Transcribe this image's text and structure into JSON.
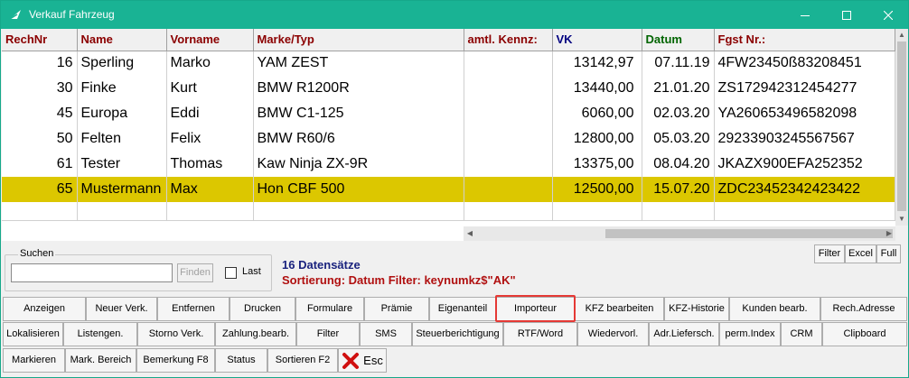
{
  "window": {
    "title": "Verkauf Fahrzeug",
    "controls": [
      "minimize-icon",
      "maximize-icon",
      "close-icon"
    ]
  },
  "grid": {
    "columns": [
      {
        "label": "RechNr",
        "color": "#8b0000"
      },
      {
        "label": "Name",
        "color": "#8b0000"
      },
      {
        "label": "Vorname",
        "color": "#8b0000"
      },
      {
        "label": "Marke/Typ",
        "color": "#8b0000"
      },
      {
        "label": "amtl. Kennz:",
        "color": "#8b0000"
      },
      {
        "label": "VK",
        "color": "#000080"
      },
      {
        "label": "Datum",
        "color": "#006400"
      },
      {
        "label": "Fgst Nr.:",
        "color": "#8b0000"
      }
    ],
    "rows": [
      [
        "16",
        "Sperling",
        "Marko",
        "YAM ZEST",
        "",
        "13142,97",
        "07.11.19",
        "4FW23450ß83208451"
      ],
      [
        "30",
        "Finke",
        "Kurt",
        "BMW R1200R",
        "",
        "13440,00",
        "21.01.20",
        "ZS172942312454277"
      ],
      [
        "45",
        "Europa",
        "Eddi",
        "BMW C1-125",
        "",
        "6060,00",
        "02.03.20",
        "YA260653496582098"
      ],
      [
        "50",
        "Felten",
        "Felix",
        "BMW R60/6",
        "",
        "12800,00",
        "05.03.20",
        "29233903245567567"
      ],
      [
        "61",
        "Tester",
        "Thomas",
        "Kaw Ninja ZX-9R",
        "",
        "13375,00",
        "08.04.20",
        "JKAZX900EFA252352"
      ],
      [
        "65",
        "Mustermann",
        "Max",
        "Hon CBF 500",
        "",
        "12500,00",
        "15.07.20",
        "ZDC23452342423422"
      ]
    ],
    "selected_row": 5,
    "selection_color": "#dcc700"
  },
  "search": {
    "group_label": "Suchen",
    "input_value": "",
    "find_label": "Finden",
    "last_label": "Last",
    "last_checked": false
  },
  "info": {
    "count": "16 Datensätze",
    "sort": "Sortierung: Datum Filter: keynumkz$\"AK\""
  },
  "mini_buttons": [
    "Filter",
    "Excel",
    "Full"
  ],
  "button_rows": [
    [
      "Anzeigen",
      "Neuer Verk.",
      "Entfernen",
      "Drucken",
      "Formulare",
      "Prämie",
      "Eigenanteil",
      "Importeur",
      "KFZ bearbeiten",
      "KFZ-Historie",
      "Kunden bearb.",
      "Rech.Adresse"
    ],
    [
      "Lokalisieren",
      "Listengen.",
      "Storno Verk.",
      "Zahlung.bearb.",
      "Filter",
      "SMS",
      "Steuerberichtigung",
      "RTF/Word",
      "Wiedervorl.",
      "Adr.Liefersch.",
      "perm.Index",
      "CRM",
      "Clipboard"
    ],
    [
      "Markieren",
      "Mark. Bereich",
      "Bemerkung F8",
      "Status",
      "Sortieren F2",
      "Esc"
    ]
  ],
  "highlighted_button": "Importeur",
  "highlight_color": "#e53935",
  "titlebar_color": "#19b394"
}
